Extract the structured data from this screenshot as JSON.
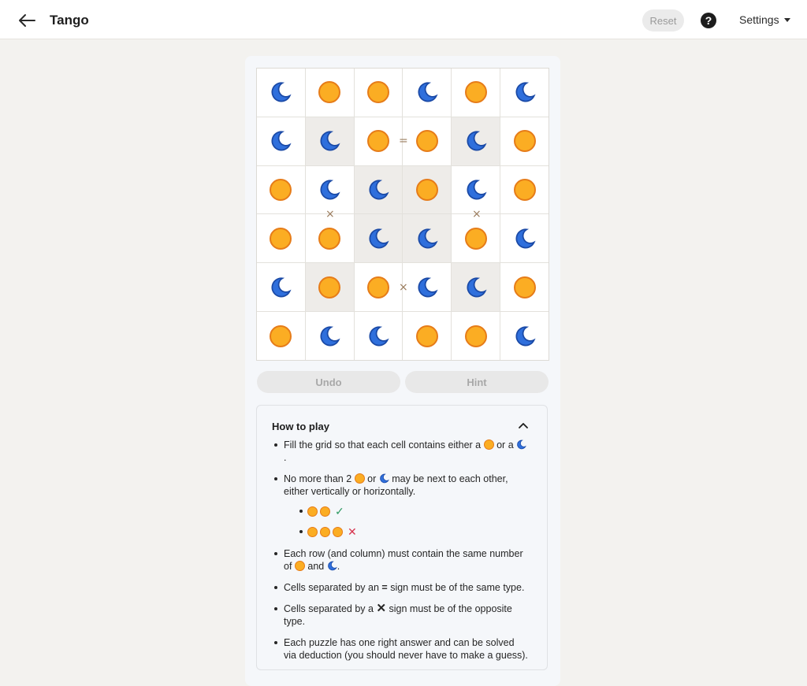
{
  "header": {
    "title": "Tango",
    "reset_label": "Reset",
    "help_label": "?",
    "settings_label": "Settings"
  },
  "board": {
    "rows": [
      [
        "moon",
        "sun",
        "sun",
        "moon",
        "sun",
        "moon"
      ],
      [
        "moon",
        "moon",
        "sun",
        "sun",
        "moon",
        "sun"
      ],
      [
        "sun",
        "moon",
        "moon",
        "sun",
        "moon",
        "sun"
      ],
      [
        "sun",
        "sun",
        "moon",
        "moon",
        "sun",
        "moon"
      ],
      [
        "moon",
        "sun",
        "sun",
        "moon",
        "moon",
        "sun"
      ],
      [
        "sun",
        "moon",
        "moon",
        "sun",
        "sun",
        "moon"
      ]
    ],
    "locked": [
      [
        1,
        1
      ],
      [
        1,
        4
      ],
      [
        2,
        2
      ],
      [
        2,
        3
      ],
      [
        3,
        2
      ],
      [
        3,
        3
      ],
      [
        4,
        1
      ],
      [
        4,
        4
      ]
    ],
    "signs": [
      {
        "type": "=",
        "between": [
          [
            1,
            2
          ],
          [
            1,
            3
          ]
        ]
      },
      {
        "type": "×",
        "between": [
          [
            2,
            1
          ],
          [
            3,
            1
          ]
        ]
      },
      {
        "type": "×",
        "between": [
          [
            2,
            4
          ],
          [
            3,
            4
          ]
        ]
      },
      {
        "type": "×",
        "between": [
          [
            4,
            2
          ],
          [
            4,
            3
          ]
        ]
      }
    ]
  },
  "controls": {
    "undo_label": "Undo",
    "hint_label": "Hint"
  },
  "how_to_play": {
    "title": "How to play",
    "rule1_a": "Fill the grid so that each cell contains either a",
    "rule1_b": "or a",
    "rule1_c": ".",
    "rule2_a": "No more than 2",
    "rule2_b": "or",
    "rule2_c": "may be next to each other, either vertically or horizontally.",
    "rule3_a": "Each row (and column) must contain the same number of",
    "rule3_b": "and",
    "rule3_c": ".",
    "rule4_a": "Cells separated by an",
    "rule4_sign": "=",
    "rule4_b": "sign must be of the same type.",
    "rule5_a": "Cells separated by a",
    "rule5_sign": "✕",
    "rule5_b": "sign must be of the opposite type.",
    "rule6": "Each puzzle has one right answer and can be solved via deduction (you should never have to make a guess).",
    "ok_mark": "✓",
    "bad_mark": "✕"
  },
  "colors": {
    "sun_fill": "#fbad23",
    "sun_stroke": "#e67c19",
    "moon_fill": "#2f6fdc",
    "moon_stroke": "#1b4aa6"
  }
}
